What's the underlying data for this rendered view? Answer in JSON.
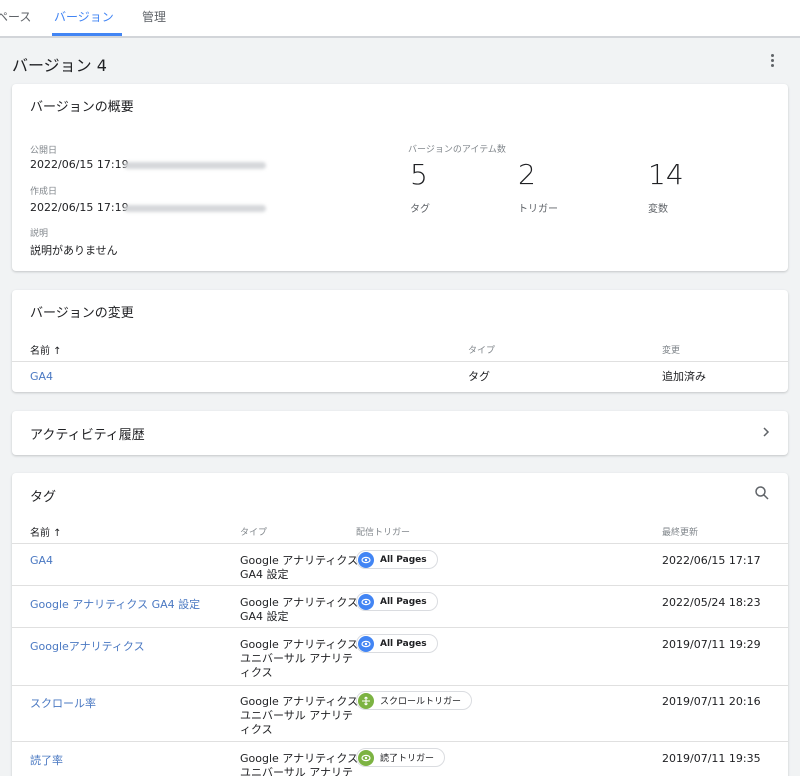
{
  "tabs": [
    {
      "label": "ペース"
    },
    {
      "label": "バージョン"
    },
    {
      "label": "管理"
    }
  ],
  "page_title": "バージョン 4",
  "overview": {
    "title": "バージョンの概要",
    "published_label": "公開日",
    "published_value": "2022/06/15 17:19",
    "created_label": "作成日",
    "created_value": "2022/06/15 17:19",
    "description_label": "説明",
    "description_value": "説明がありません",
    "items_label": "バージョンのアイテム数",
    "stats": [
      {
        "count": "5",
        "label": "タグ"
      },
      {
        "count": "2",
        "label": "トリガー"
      },
      {
        "count": "14",
        "label": "変数"
      }
    ]
  },
  "changes": {
    "title": "バージョンの変更",
    "headers": {
      "name": "名前 ↑",
      "type": "タイプ",
      "change": "変更"
    },
    "rows": [
      {
        "name": "GA4",
        "type": "タグ",
        "change": "追加済み"
      }
    ]
  },
  "activity": {
    "title": "アクティビティ履歴"
  },
  "tags": {
    "title": "タグ",
    "headers": {
      "name": "名前 ↑",
      "type": "タイプ",
      "trigger": "配信トリガー",
      "updated": "最終更新"
    },
    "rows": [
      {
        "name": "GA4",
        "type_l1": "Google アナリティクス:",
        "type_l2": "GA4 設定",
        "type_l3": "",
        "trigger": "All Pages",
        "trigger_icon": "eye-icon",
        "trigger_color": "#4285f4",
        "updated": "2022/06/15 17:17"
      },
      {
        "name": "Google アナリティクス GA4 設定",
        "type_l1": "Google アナリティクス:",
        "type_l2": "GA4 設定",
        "type_l3": "",
        "trigger": "All Pages",
        "trigger_icon": "eye-icon",
        "trigger_color": "#4285f4",
        "updated": "2022/05/24 18:23"
      },
      {
        "name": "Googleアナリティクス",
        "type_l1": "Google アナリティクス:",
        "type_l2": "ユニバーサル アナリテ",
        "type_l3": "ィクス",
        "trigger": "All Pages",
        "trigger_icon": "eye-icon",
        "trigger_color": "#4285f4",
        "updated": "2019/07/11 19:29"
      },
      {
        "name": "スクロール率",
        "type_l1": "Google アナリティクス:",
        "type_l2": "ユニバーサル アナリテ",
        "type_l3": "ィクス",
        "trigger": "スクロールトリガー",
        "trigger_icon": "scroll-icon",
        "trigger_color": "#7cb342",
        "updated": "2019/07/11 20:16"
      },
      {
        "name": "読了率",
        "type_l1": "Google アナリティクス:",
        "type_l2": "ユニバーサル アナリテ",
        "type_l3": "",
        "trigger": "読了トリガー",
        "trigger_icon": "eye-icon",
        "trigger_color": "#7cb342",
        "updated": "2019/07/11 19:35"
      }
    ]
  }
}
